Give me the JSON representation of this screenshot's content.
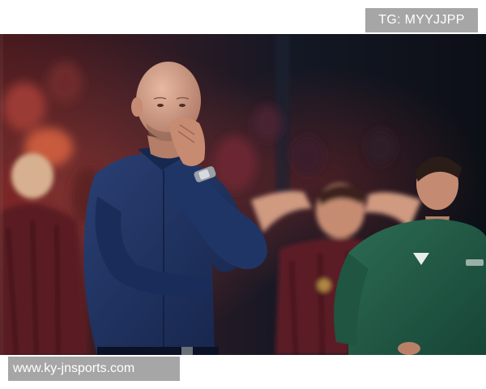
{
  "watermark_top": "TG: MYYJJPP",
  "watermark_bottom": "www.ky-jnsports.com",
  "palette": {
    "background": "#ffffff",
    "watermark_box": "#a6a6a6",
    "watermark_text": "#ffffff",
    "crowd_red": "#7a1f24",
    "coach_shirt": "#1c2f5c",
    "official_green": "#1f5a45"
  }
}
